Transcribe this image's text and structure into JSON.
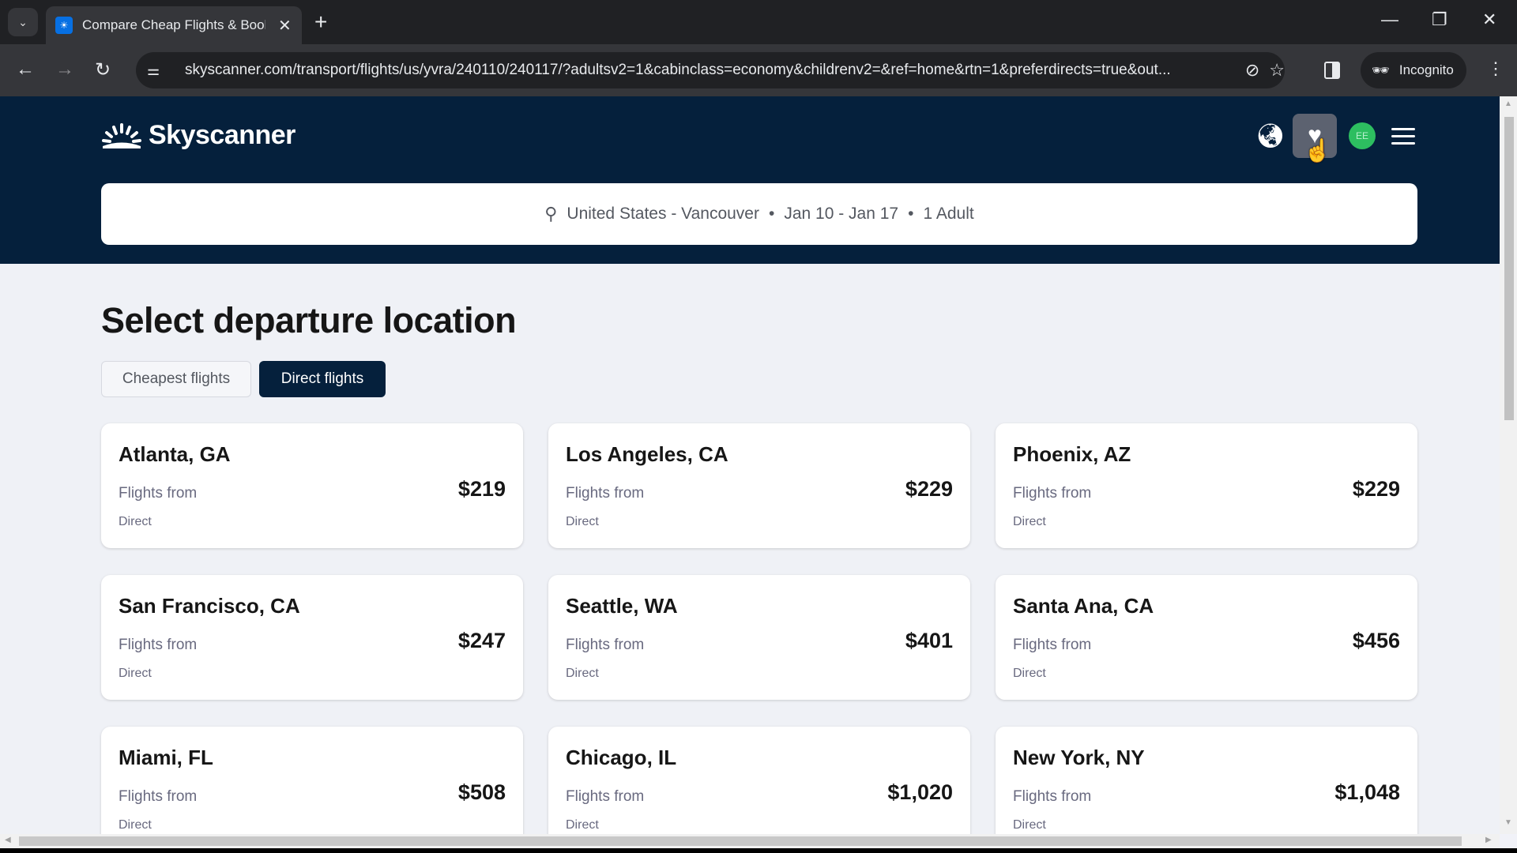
{
  "browser": {
    "tab_title": "Compare Cheap Flights & Book",
    "url": "skyscanner.com/transport/flights/us/yvra/240110/240117/?adultsv2=1&cabinclass=economy&childrenv2=&ref=home&rtn=1&preferdirects=true&out...",
    "incognito_label": "Incognito"
  },
  "header": {
    "brand": "Skyscanner",
    "avatar_initials": "EE",
    "accent_color": "#05203c"
  },
  "search": {
    "route": "United States - Vancouver",
    "dates": "Jan 10 - Jan 17",
    "travellers": "1 Adult",
    "separator": "•"
  },
  "main": {
    "title": "Select departure location",
    "filters": [
      {
        "label": "Cheapest flights",
        "active": false
      },
      {
        "label": "Direct flights",
        "active": true
      }
    ],
    "destinations": [
      {
        "city": "Atlanta, GA",
        "from_label": "Flights from",
        "price": "$219",
        "stops": "Direct"
      },
      {
        "city": "Los Angeles, CA",
        "from_label": "Flights from",
        "price": "$229",
        "stops": "Direct"
      },
      {
        "city": "Phoenix, AZ",
        "from_label": "Flights from",
        "price": "$229",
        "stops": "Direct"
      },
      {
        "city": "San Francisco, CA",
        "from_label": "Flights from",
        "price": "$247",
        "stops": "Direct"
      },
      {
        "city": "Seattle, WA",
        "from_label": "Flights from",
        "price": "$401",
        "stops": "Direct"
      },
      {
        "city": "Santa Ana, CA",
        "from_label": "Flights from",
        "price": "$456",
        "stops": "Direct"
      },
      {
        "city": "Miami, FL",
        "from_label": "Flights from",
        "price": "$508",
        "stops": "Direct"
      },
      {
        "city": "Chicago, IL",
        "from_label": "Flights from",
        "price": "$1,020",
        "stops": "Direct"
      },
      {
        "city": "New York, NY",
        "from_label": "Flights from",
        "price": "$1,048",
        "stops": "Direct"
      }
    ]
  }
}
